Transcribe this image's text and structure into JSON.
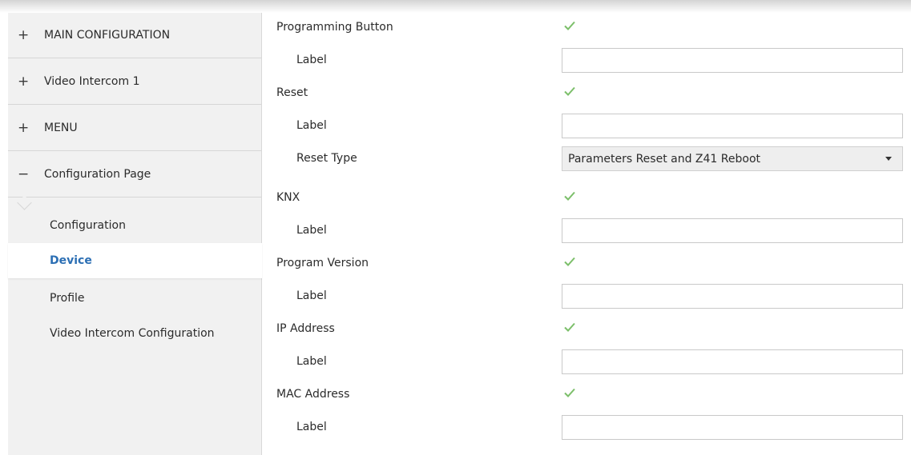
{
  "sidebar": {
    "sections": [
      {
        "toggle": "+",
        "label": "MAIN CONFIGURATION"
      },
      {
        "toggle": "+",
        "label": "Video Intercom 1"
      },
      {
        "toggle": "+",
        "label": "MENU"
      },
      {
        "toggle": "−",
        "label": "Configuration Page"
      }
    ],
    "subitems": [
      {
        "label": "Configuration",
        "active": false
      },
      {
        "label": "Device",
        "active": true
      },
      {
        "label": "Profile",
        "active": false
      },
      {
        "label": "Video Intercom Configuration",
        "active": false
      }
    ]
  },
  "main": {
    "rows": [
      {
        "label": "Programming Button",
        "control": "checkbox",
        "checked": true
      },
      {
        "label": "Label",
        "control": "text",
        "value": ""
      },
      {
        "label": "Reset",
        "control": "checkbox",
        "checked": true
      },
      {
        "label": "Label",
        "control": "text",
        "value": ""
      },
      {
        "label": "Reset Type",
        "control": "select",
        "value": "Parameters Reset and Z41 Reboot"
      },
      {
        "label": "KNX",
        "control": "checkbox",
        "checked": true
      },
      {
        "label": "Label",
        "control": "text",
        "value": ""
      },
      {
        "label": "Program Version",
        "control": "checkbox",
        "checked": true
      },
      {
        "label": "Label",
        "control": "text",
        "value": ""
      },
      {
        "label": "IP Address",
        "control": "checkbox",
        "checked": true
      },
      {
        "label": "Label",
        "control": "text",
        "value": ""
      },
      {
        "label": "MAC Address",
        "control": "checkbox",
        "checked": true
      },
      {
        "label": "Label",
        "control": "text",
        "value": ""
      }
    ]
  },
  "icons": {
    "checkmark": "check-icon",
    "dropdown": "chevron-down-icon"
  },
  "colors": {
    "accent": "#2c6fb4",
    "check": "#7cbf6a",
    "sidebar_bg": "#f1f1f1"
  }
}
